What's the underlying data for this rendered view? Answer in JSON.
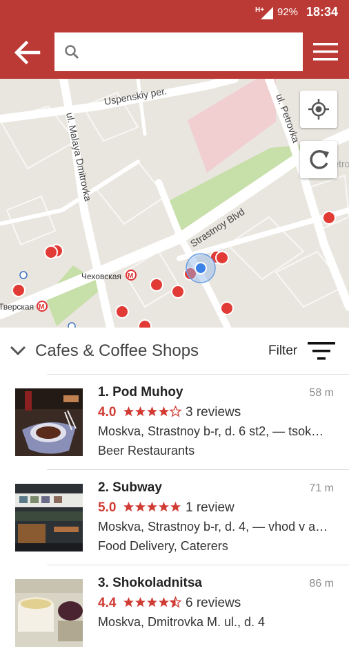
{
  "status_bar": {
    "network": "H+",
    "battery": "92%",
    "time": "18:34"
  },
  "header": {
    "search": {
      "placeholder": "",
      "value": ""
    }
  },
  "map": {
    "street_labels": [
      "Uspenskiy per.",
      "ul. Petrovka",
      "ul. Malaya Dmitrovka",
      "Strastnoy Blvd",
      "Petrov",
      "Чеховская",
      "Тверская"
    ],
    "metro_icon": "metro-icon",
    "controls": [
      "my-location-icon",
      "refresh-icon"
    ]
  },
  "category": {
    "title": "Cafes & Coffee Shops",
    "filter_label": "Filter"
  },
  "results": [
    {
      "name": "1. Pod Muhoy",
      "distance": "58 m",
      "rating": "4.0",
      "stars": 4,
      "reviews": "3 reviews",
      "address": "Moskva, Strastnoy b-r, d. 6 st2, — tsok…",
      "categories": "Beer Restaurants"
    },
    {
      "name": "2. Subway",
      "distance": "71 m",
      "rating": "5.0",
      "stars": 5,
      "reviews": "1 review",
      "address": "Moskva, Strastnoy b-r, d. 4, — vhod v a…",
      "categories": "Food Delivery, Caterers"
    },
    {
      "name": "3. Shokoladnitsa",
      "distance": "86 m",
      "rating": "4.4",
      "stars": 4.5,
      "reviews": "6 reviews",
      "address": "Moskva, Dmitrovka M. ul., d. 4",
      "categories": ""
    }
  ],
  "colors": {
    "brand": "#bb3a35",
    "rating": "#d03b33",
    "pin": "#e23b35",
    "location": "#3b82e6"
  }
}
